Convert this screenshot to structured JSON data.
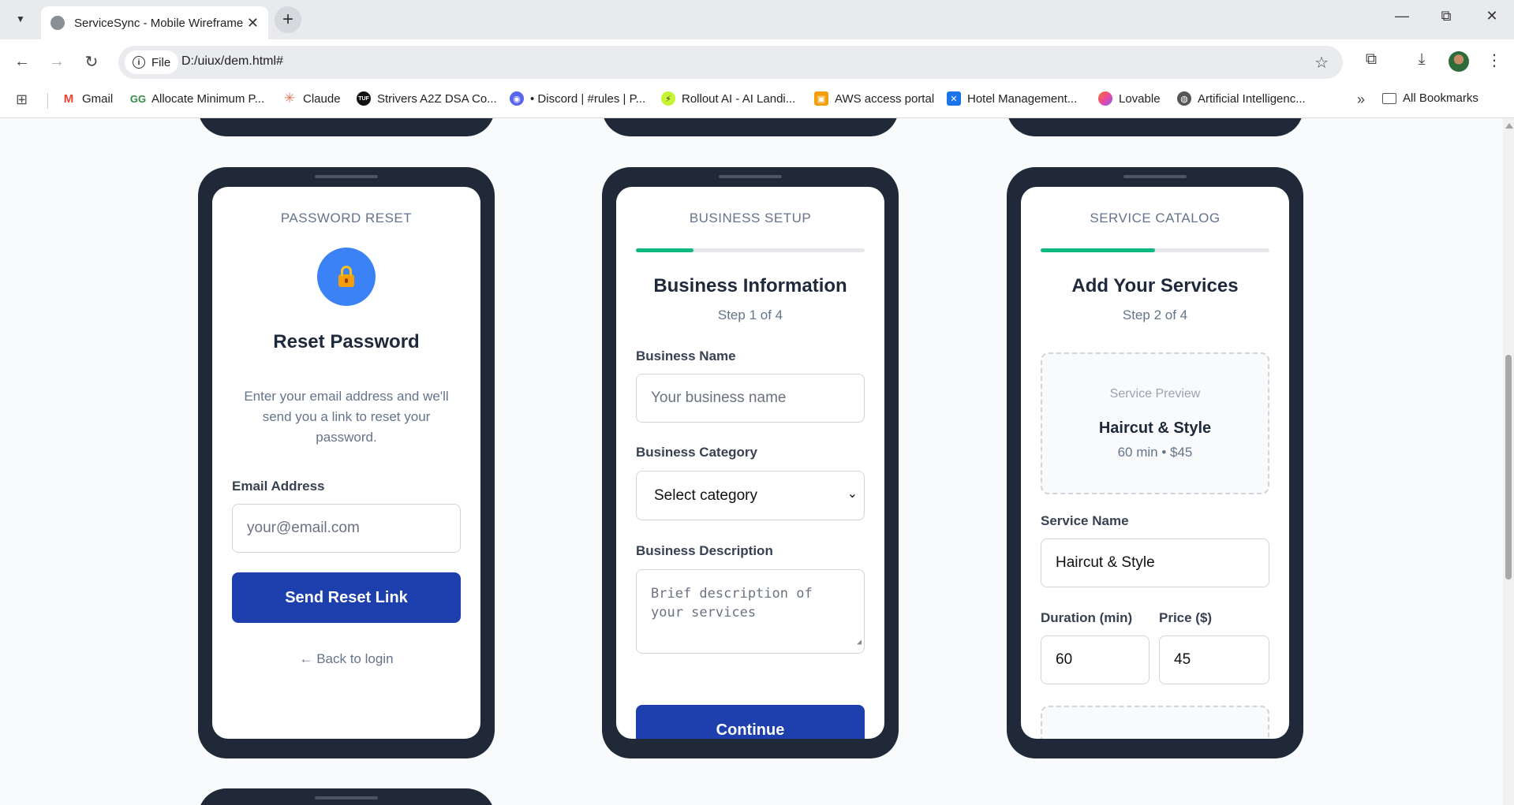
{
  "browser": {
    "tab_title": "ServiceSync - Mobile Wireframe",
    "new_tab": "+",
    "close": "✕",
    "site_chip": "File",
    "url": "D:/uiux/dem.html#",
    "bookmarks": [
      "Gmail",
      "Allocate Minimum P...",
      "Claude",
      "Strivers A2Z DSA Co...",
      "• Discord | #rules | P...",
      "Rollout AI - AI Landi...",
      "AWS access portal",
      "Hotel Management...",
      "Lovable",
      "Artificial Intelligenc..."
    ],
    "all_bookmarks": "All Bookmarks",
    "more": "»"
  },
  "password_reset": {
    "header": "PASSWORD RESET",
    "title": "Reset Password",
    "description": "Enter your email address and we'll send you a link to reset your password.",
    "email_label": "Email Address",
    "email_placeholder": "your@email.com",
    "button": "Send Reset Link",
    "back_link": "← Back to login"
  },
  "business_setup": {
    "header": "BUSINESS SETUP",
    "progress": 0.25,
    "title": "Business Information",
    "step": "Step 1 of 4",
    "name_label": "Business Name",
    "name_placeholder": "Your business name",
    "category_label": "Business Category",
    "category_value": "Select category",
    "description_label": "Business Description",
    "description_placeholder": "Brief description of your services",
    "button": "Continue"
  },
  "service_catalog": {
    "header": "SERVICE CATALOG",
    "progress": 0.5,
    "title": "Add Your Services",
    "step": "Step 2 of 4",
    "preview_label": "Service Preview",
    "preview_name": "Haircut & Style",
    "preview_meta": "60 min • $45",
    "name_label": "Service Name",
    "name_value": "Haircut & Style",
    "duration_label": "Duration (min)",
    "duration_value": "60",
    "price_label": "Price ($)",
    "price_value": "45"
  },
  "colors": {
    "accent_button": "#1e40af",
    "progress": "#10b981",
    "lock_circle": "#3b82f6",
    "phone_frame": "#1f2937"
  }
}
